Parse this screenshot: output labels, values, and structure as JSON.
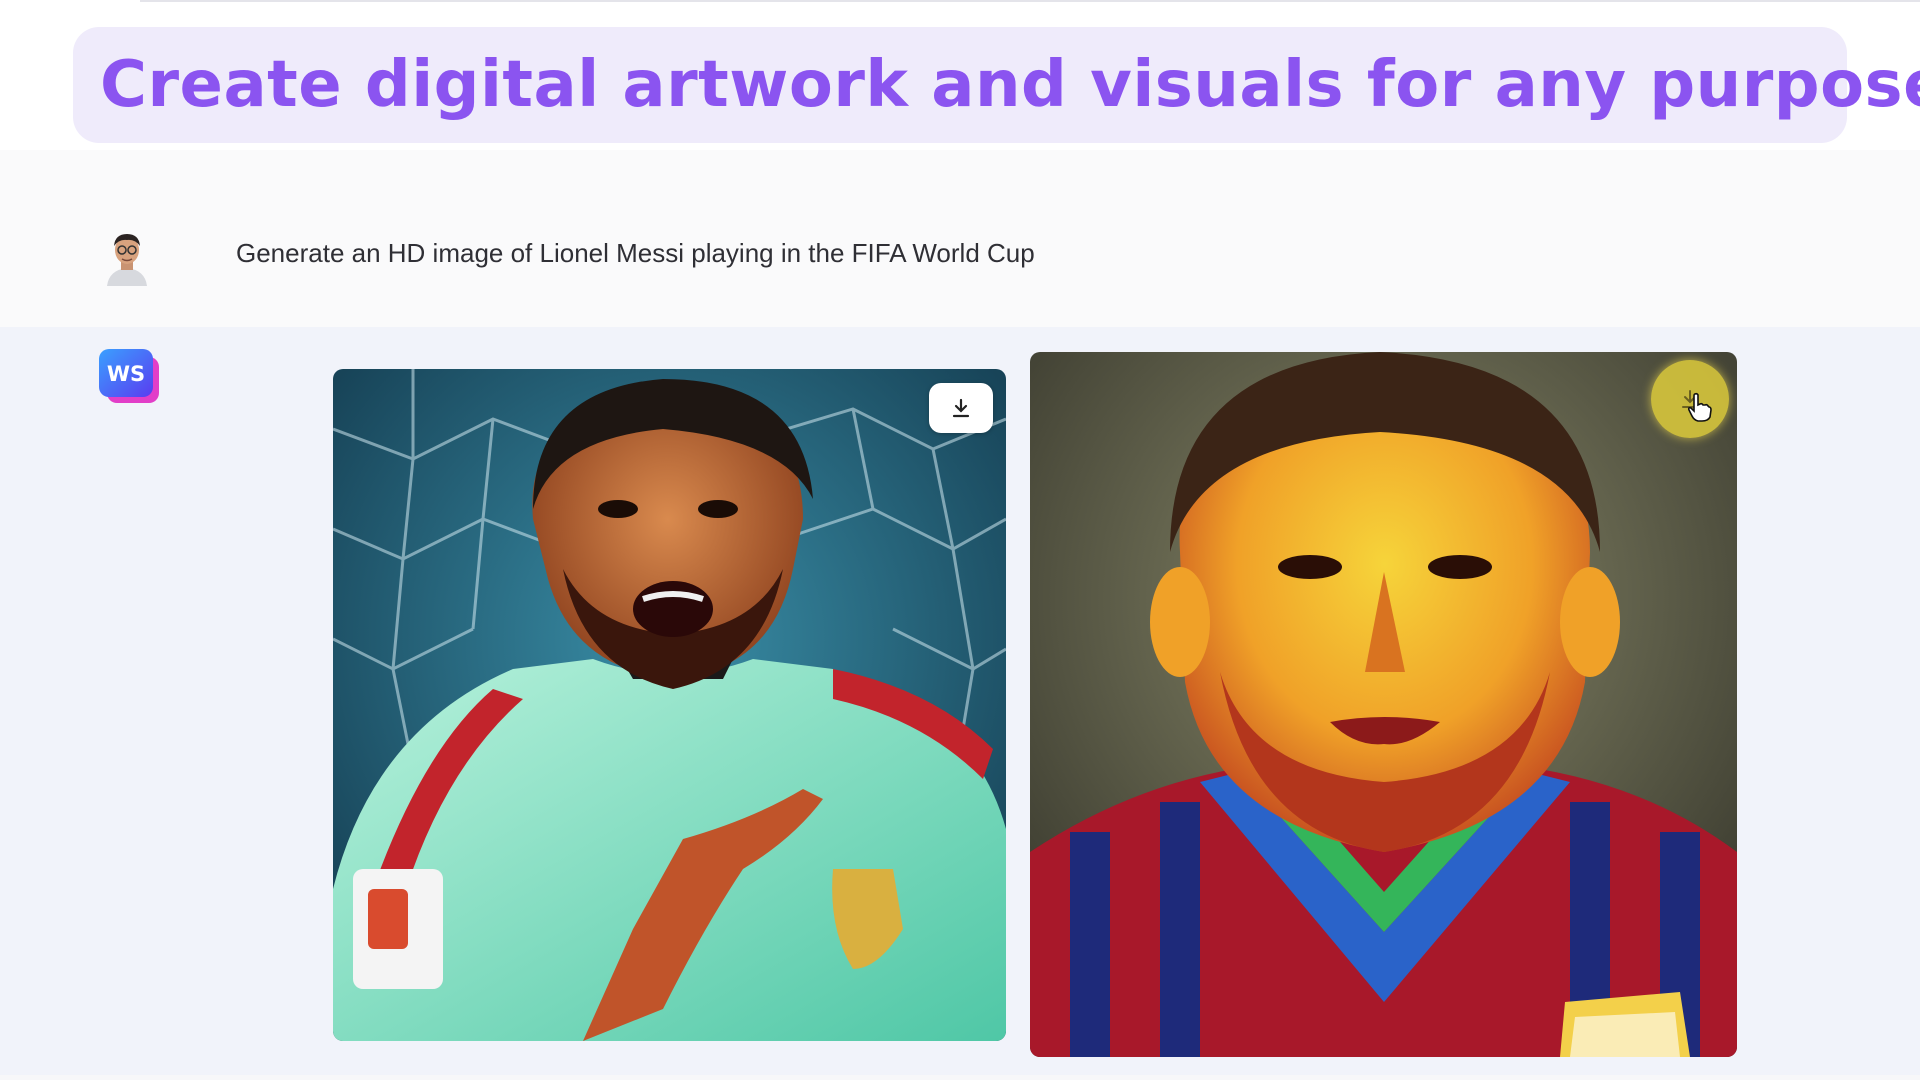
{
  "banner": {
    "text": "Create digital artwork and visuals for any purpose."
  },
  "chat": {
    "user_prompt": "Generate an HD image of Lionel Messi playing in the FIFA World Cup"
  },
  "response": {
    "images": [
      {
        "alt": "Generated image 1",
        "download_icon": "download-icon"
      },
      {
        "alt": "Generated image 2",
        "download_icon": "download-icon"
      }
    ]
  },
  "logo": {
    "text": "WS"
  },
  "colors": {
    "accent": "#8b54f0",
    "banner_bg": "#efebfb",
    "response_bg": "#f1f3fa",
    "download_hover": "#decd3c"
  }
}
